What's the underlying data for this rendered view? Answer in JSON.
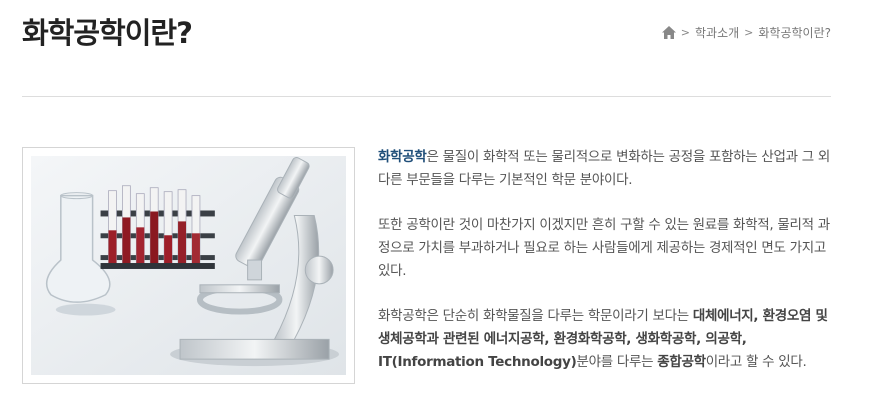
{
  "header": {
    "title": "화학공학이란?"
  },
  "breadcrumb": {
    "items": [
      "학과소개",
      "화학공학이란?"
    ],
    "separator": ">"
  },
  "figure": {
    "icon": "lab-equipment-image"
  },
  "content": {
    "p1": {
      "term": "화학공학",
      "rest": "은 물질이 화학적 또는 물리적으로 변화하는 공정을 포함하는 산업과 그 외 다른 부문들을 다루는 기본적인 학문 분야이다."
    },
    "p2": "또한 공학이란 것이 마찬가지 이겠지만 흔히 구할 수 있는 원료를 화학적, 물리적 과정으로 가치를 부과하거나 필요로 하는 사람들에게 제공하는 경제적인 면도 가지고 있다.",
    "p3": {
      "intro": "화학공학은 단순히 화학물질을 다루는 학문이라기 보다는 ",
      "fields1": "대체에너지, 환경오염 및 생체공학과 관련된 에너지공학, 환경화학공학, 생화학공학, 의공학, IT(Information Technology)",
      "mid": "분야를 다루는 ",
      "fields2": "종합공학",
      "end": "이라고 할 수 있다."
    }
  },
  "colors": {
    "highlight": "#1f4e79",
    "divider": "#dddddd"
  }
}
